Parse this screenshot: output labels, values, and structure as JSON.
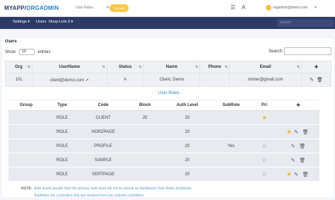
{
  "header": {
    "logo_main": "MYAPP/",
    "logo_accent": "ORGADMIN",
    "roles_select": "User Roles",
    "back_label": "Go Back",
    "user_email": "orgadmin@demo.com"
  },
  "nav": {
    "settings": "Settings",
    "users": "Users",
    "noop": "Noop-Link-3",
    "search_placeholder": "Search"
  },
  "users": {
    "title": "Users",
    "show_label": "Show",
    "show_value": "10",
    "entries_label": "entries",
    "search_label": "Search:",
    "columns": [
      "Org",
      "UserName",
      "Status",
      "Name",
      "Phone",
      "Email"
    ],
    "rows": [
      {
        "org": "101",
        "username": "client@demo.com",
        "status": "A",
        "name": "Client, Demo",
        "phone": "",
        "email": "mister@gmail.com"
      }
    ]
  },
  "user_roles": {
    "title": "User Roles",
    "columns": [
      "Group",
      "Type",
      "Code",
      "Block",
      "Auth Level",
      "SubRole",
      "Pri"
    ],
    "rows": [
      {
        "group": "",
        "type": "ROLE",
        "code": "CLIENT",
        "block": "25",
        "auth": "20",
        "subrole": "",
        "starred": true
      },
      {
        "group": "",
        "type": "ROLE",
        "code": "HORZPAGE",
        "block": "",
        "auth": "20",
        "subrole": "",
        "starred": true
      },
      {
        "group": "",
        "type": "ROLE",
        "code": "PROFILE",
        "block": "",
        "auth": "20",
        "subrole": "Yes",
        "starred": false
      },
      {
        "group": "",
        "type": "ROLE",
        "code": "SAMPLE",
        "block": "",
        "auth": "20",
        "subrole": "",
        "starred": false
      },
      {
        "group": "",
        "type": "ROLE",
        "code": "VERTPAGE",
        "block": "",
        "auth": "20",
        "subrole": "",
        "starred": false
      }
    ]
  },
  "notes": {
    "label": "NOTE:",
    "line1": "Auth levels greater than the primary auth level will not be shown as dashboard User Roles dropdown",
    "line2": "SubRoles are controllers that are invoked from non-subrole controllers"
  },
  "icons": {
    "star_on_color": "#f2b01e",
    "star_off_color": "#777777",
    "accent": "#2a7fc1",
    "navbar": "#2b3a67"
  }
}
